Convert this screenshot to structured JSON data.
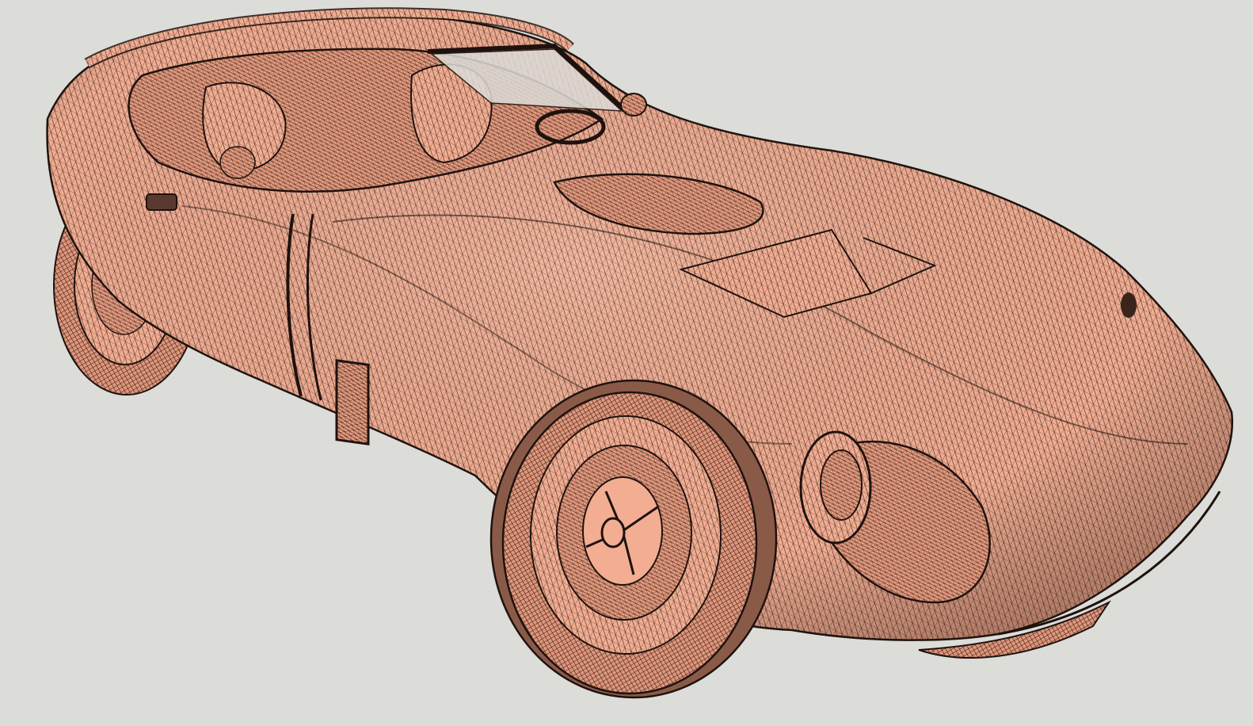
{
  "viewport": {
    "background_color": "#dcdcd8",
    "model_fill_color": "#f2ad92",
    "model_shade_color": "#c9836a",
    "wire_color": "#2a1a14",
    "render_mode": "shaded-with-edges"
  }
}
